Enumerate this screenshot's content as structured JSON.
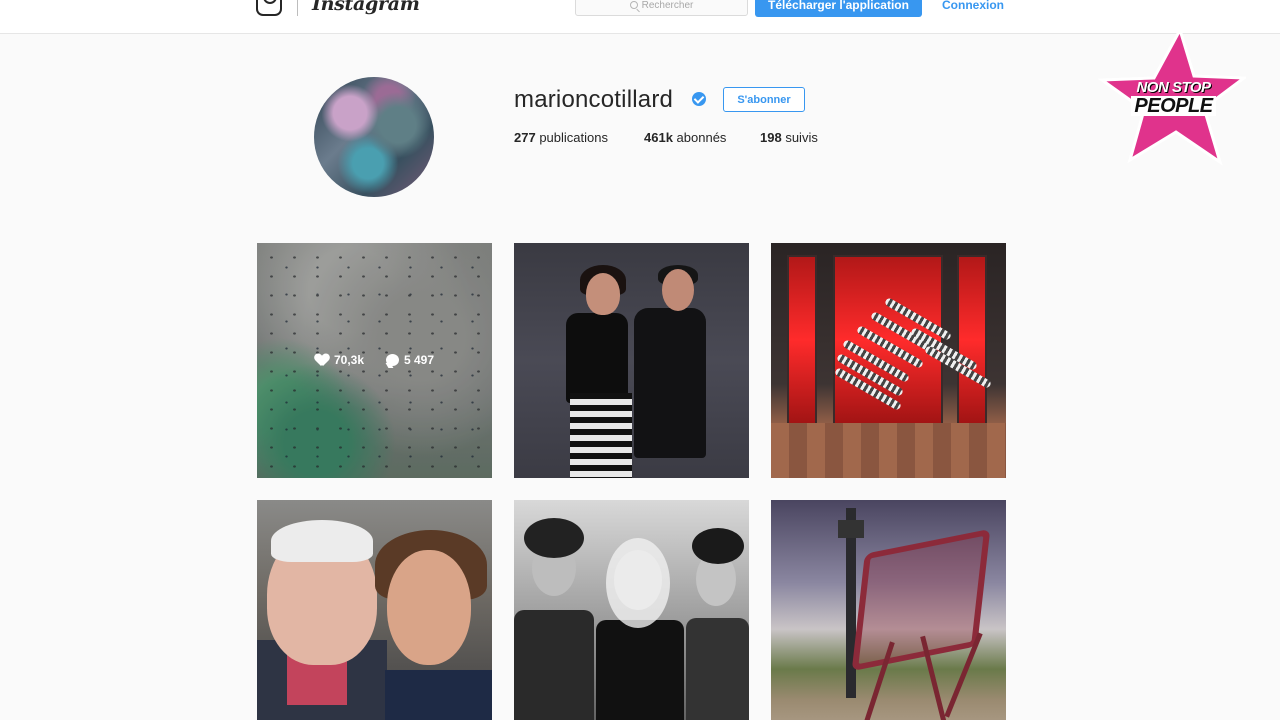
{
  "header": {
    "wordmark": "Instagram",
    "search_placeholder": "Rechercher",
    "download_button": "Télécharger l'application",
    "login_link": "Connexion"
  },
  "profile": {
    "username": "marioncotillard",
    "verified": true,
    "follow_button": "S'abonner",
    "stats": [
      {
        "count": "277",
        "label": "publications"
      },
      {
        "count": "461k",
        "label": "abonnés"
      },
      {
        "count": "198",
        "label": "suivis"
      }
    ]
  },
  "posts": [
    {
      "likes": "70,3k",
      "comments": "5 497",
      "hovered": true
    },
    {
      "hovered": false
    },
    {
      "hovered": false
    },
    {
      "hovered": false
    },
    {
      "hovered": false
    },
    {
      "hovered": false
    }
  ],
  "watermark": {
    "line1": "NON STOP",
    "line2": "PEOPLE"
  },
  "colors": {
    "accent": "#3897f0",
    "watermark_star": "#e0338c",
    "background": "#fafafa"
  }
}
